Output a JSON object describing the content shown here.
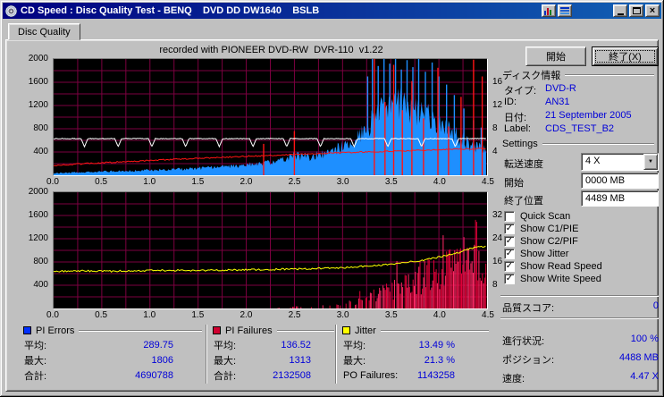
{
  "titlebar": {
    "title": "CD Speed : Disc Quality Test - BENQ    DVD DD DW1640    BSLB"
  },
  "icons": {
    "close": "×",
    "dropdown": "▼",
    "check": "✓"
  },
  "tab": {
    "label": "Disc Quality"
  },
  "chart_header": "recorded with PIONEER DVD-RW  DVR-110  v1.22",
  "buttons": {
    "start": "開始",
    "exit": "終了(X)"
  },
  "disc_info": {
    "title": "ディスク情報",
    "type_label": "タイプ:",
    "type_value": "DVD-R",
    "id_label": "ID:",
    "id_value": "AN31",
    "date_label": "日付:",
    "date_value": "21 September 2005",
    "label_label": "Label:",
    "label_value": "CDS_TEST_B2"
  },
  "settings": {
    "title": "Settings",
    "speed_label": "転送速度",
    "speed_value": "4 X",
    "start_label": "開始",
    "start_value": "0000 MB",
    "end_label": "終了位置",
    "end_value": "4489 MB"
  },
  "checkboxes": [
    {
      "label": "Quick Scan",
      "checked": false
    },
    {
      "label": "Show C1/PIE",
      "checked": true
    },
    {
      "label": "Show C2/PIF",
      "checked": true
    },
    {
      "label": "Show Jitter",
      "checked": true
    },
    {
      "label": "Show Read Speed",
      "checked": true
    },
    {
      "label": "Show Write Speed",
      "checked": true
    }
  ],
  "quality_score": {
    "label": "品質スコア:",
    "value": "0"
  },
  "status": {
    "progress_label": "進行状況:",
    "progress_value": "100 %",
    "position_label": "ポジション:",
    "position_value": "4488 MB",
    "speed_label": "速度:",
    "speed_value": "4.47 X"
  },
  "stats": {
    "avg_label": "平均:",
    "max_label": "最大:",
    "total_label": "合計:",
    "po_label": "PO Failures:",
    "pi_errors": {
      "title": "PI Errors",
      "color": "#0030ff",
      "avg": "289.75",
      "max": "1806",
      "total": "4690788"
    },
    "pi_failures": {
      "title": "PI Failures",
      "color": "#d00030",
      "avg": "136.52",
      "max": "1313",
      "total": "2132508"
    },
    "jitter": {
      "title": "Jitter",
      "color": "#ffff00",
      "avg": "13.49 %",
      "max": "21.3 %",
      "po": "1143258"
    }
  },
  "chart_data": [
    {
      "type": "area",
      "title": "PI Errors vs position (GB) with read/write speed",
      "bg": "#000000",
      "grid_color": "#7c0040",
      "x_range": [
        0,
        4.5
      ],
      "x_ticks": [
        "0.0",
        "0.5",
        "1.0",
        "1.5",
        "2.0",
        "2.5",
        "3.0",
        "3.5",
        "4.0",
        "4.5"
      ],
      "y_left": {
        "max": 2000,
        "ticks": [
          2000,
          1600,
          1200,
          800,
          400
        ]
      },
      "y_right": {
        "max": 20,
        "ticks": [
          {
            "v": 1600,
            "t": "16"
          },
          {
            "v": 1200,
            "t": "12"
          },
          {
            "v": 800,
            "t": "8"
          },
          {
            "v": 400,
            "t": "4"
          }
        ]
      },
      "series": [
        {
          "name": "pi_errors",
          "kind": "area",
          "color": "#1e8fff",
          "points": [
            [
              0,
              35
            ],
            [
              0.3,
              50
            ],
            [
              0.6,
              65
            ],
            [
              0.9,
              80
            ],
            [
              1.2,
              95
            ],
            [
              1.5,
              115
            ],
            [
              1.8,
              140
            ],
            [
              2.1,
              185
            ],
            [
              2.35,
              240
            ],
            [
              2.5,
              330
            ],
            [
              2.65,
              310
            ],
            [
              2.8,
              360
            ],
            [
              3.0,
              470
            ],
            [
              3.1,
              560
            ],
            [
              3.2,
              680
            ],
            [
              3.3,
              880
            ],
            [
              3.4,
              1080
            ],
            [
              3.5,
              1230
            ],
            [
              3.55,
              1260
            ],
            [
              3.65,
              1180
            ],
            [
              3.75,
              1090
            ],
            [
              3.85,
              1010
            ],
            [
              3.95,
              930
            ],
            [
              4.05,
              820
            ],
            [
              4.15,
              700
            ],
            [
              4.25,
              590
            ],
            [
              4.35,
              500
            ],
            [
              4.45,
              440
            ],
            [
              4.49,
              410
            ]
          ]
        },
        {
          "name": "pi_errors_spikes",
          "kind": "spikes",
          "color": "#1e8fff",
          "points": [
            [
              3.26,
              1700
            ],
            [
              3.31,
              2000
            ],
            [
              3.37,
              1880
            ],
            [
              3.43,
              2000
            ],
            [
              3.49,
              1920
            ],
            [
              3.55,
              2000
            ],
            [
              3.61,
              1820
            ],
            [
              3.67,
              1980
            ],
            [
              3.73,
              1860
            ],
            [
              3.79,
              2000
            ],
            [
              3.86,
              1780
            ],
            [
              3.93,
              1940
            ],
            [
              4.0,
              1700
            ],
            [
              4.08,
              1560
            ],
            [
              4.16,
              1380
            ],
            [
              4.26,
              1150
            ],
            [
              4.36,
              950
            ],
            [
              4.44,
              820
            ]
          ]
        },
        {
          "name": "write_speed_spikes",
          "kind": "spikes",
          "color": "#ff1414",
          "points": [
            [
              2.18,
              540
            ],
            [
              2.5,
              760
            ],
            [
              3.33,
              2000
            ],
            [
              3.44,
              1260
            ],
            [
              3.53,
              1900
            ],
            [
              3.62,
              1120
            ],
            [
              3.72,
              1620
            ],
            [
              3.84,
              980
            ],
            [
              3.99,
              1850
            ],
            [
              4.1,
              840
            ],
            [
              4.23,
              1350
            ],
            [
              4.36,
              1990
            ],
            [
              4.45,
              1700
            ]
          ]
        },
        {
          "name": "write_speed",
          "kind": "line",
          "color": "#ff1414",
          "noise": 22,
          "points": [
            [
              0,
              170
            ],
            [
              0.5,
              215
            ],
            [
              1.0,
              255
            ],
            [
              1.5,
              292
            ],
            [
              2.0,
              326
            ],
            [
              2.5,
              358
            ],
            [
              3.0,
              388
            ],
            [
              3.5,
              415
            ],
            [
              4.0,
              440
            ],
            [
              4.49,
              460
            ]
          ]
        },
        {
          "name": "read_speed",
          "kind": "dipline",
          "color": "#ffffff",
          "noise": 12,
          "base": 630,
          "dip_start": 0.32,
          "dip_interval": 0.35,
          "dip_depth": 140
        }
      ]
    },
    {
      "type": "bar",
      "title": "PI Failures vs position (GB) with jitter",
      "bg": "#000000",
      "grid_color": "#7c0040",
      "x_range": [
        0,
        4.5
      ],
      "x_ticks": [
        "0.0",
        "0.5",
        "1.0",
        "1.5",
        "2.0",
        "2.5",
        "3.0",
        "3.5",
        "4.0",
        "4.5"
      ],
      "y_left": {
        "max": 2000,
        "ticks": [
          2000,
          1600,
          1200,
          800,
          400
        ]
      },
      "y_right": {
        "max": 40,
        "ticks": [
          {
            "v": 1600,
            "t": "32"
          },
          {
            "v": 1200,
            "t": "24"
          },
          {
            "v": 800,
            "t": "16"
          },
          {
            "v": 400,
            "t": "8"
          }
        ]
      },
      "series": [
        {
          "name": "pi_failures",
          "kind": "bars",
          "color": "#e00038",
          "alt_color": "#ff2864",
          "points": [
            [
              0,
              0
            ],
            [
              2.3,
              0
            ],
            [
              2.4,
              30
            ],
            [
              2.6,
              50
            ],
            [
              2.8,
              62
            ],
            [
              3.0,
              95
            ],
            [
              3.1,
              135
            ],
            [
              3.2,
              185
            ],
            [
              3.3,
              255
            ],
            [
              3.4,
              330
            ],
            [
              3.5,
              400
            ],
            [
              3.6,
              470
            ],
            [
              3.7,
              560
            ],
            [
              3.8,
              660
            ],
            [
              3.9,
              760
            ],
            [
              4.0,
              860
            ],
            [
              4.1,
              960
            ],
            [
              4.2,
              1060
            ],
            [
              4.3,
              1160
            ],
            [
              4.38,
              1290
            ],
            [
              4.44,
              1230
            ],
            [
              4.49,
              1160
            ]
          ]
        },
        {
          "name": "jitter",
          "kind": "line",
          "color": "#ffff00",
          "noise": 30,
          "points": [
            [
              0,
              640
            ],
            [
              0.3,
              646
            ],
            [
              0.6,
              641
            ],
            [
              0.9,
              650
            ],
            [
              1.2,
              656
            ],
            [
              1.5,
              654
            ],
            [
              1.8,
              661
            ],
            [
              2.1,
              666
            ],
            [
              2.4,
              676
            ],
            [
              2.7,
              686
            ],
            [
              3.0,
              702
            ],
            [
              3.2,
              722
            ],
            [
              3.4,
              746
            ],
            [
              3.6,
              778
            ],
            [
              3.8,
              822
            ],
            [
              4.0,
              882
            ],
            [
              4.2,
              962
            ],
            [
              4.33,
              1030
            ],
            [
              4.43,
              1072
            ],
            [
              4.49,
              1058
            ]
          ]
        }
      ]
    }
  ]
}
